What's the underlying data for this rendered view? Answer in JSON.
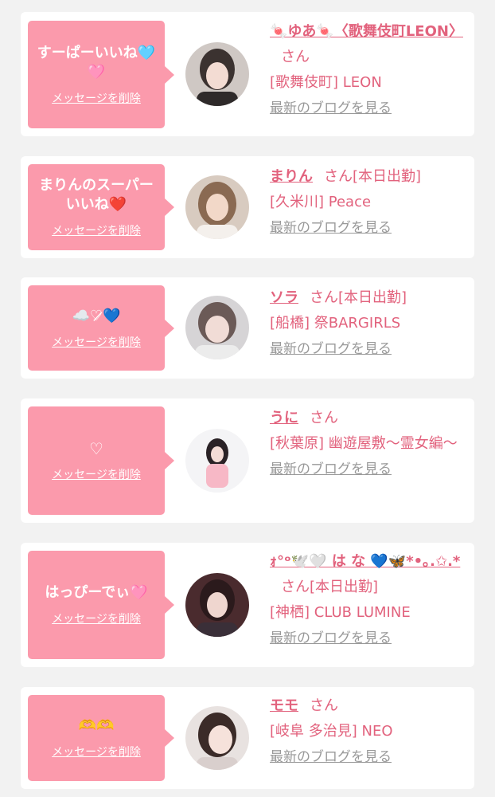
{
  "cards": [
    {
      "message": "すーぱーいいね🩵🩷",
      "delete_label": "メッセージを削除",
      "name": "🍬ゆあ🍬〈歌舞伎町LEON〉",
      "honorific": "さん",
      "status": "",
      "shop": "[歌舞伎町] LEON",
      "blog_link": "最新のブログを見る"
    },
    {
      "message": "まりんのスーパーいいね❤️",
      "delete_label": "メッセージを削除",
      "name": "まりん",
      "honorific": "さん",
      "status": "[本日出勤]",
      "shop": "[久米川] Peace",
      "blog_link": "最新のブログを見る"
    },
    {
      "message": "☁️♡̷💙",
      "delete_label": "メッセージを削除",
      "name": "ソラ",
      "honorific": "さん",
      "status": "[本日出勤]",
      "shop": "[船橋] 祭BARGIRLS",
      "blog_link": "最新のブログを見る"
    },
    {
      "message": "♡",
      "delete_label": "メッセージを削除",
      "name": "うに",
      "honorific": "さん",
      "status": "",
      "shop": "[秋葉原] 幽遊屋敷〜霊女編〜",
      "blog_link": "最新のブログを見る"
    },
    {
      "message": "はっぴーでぃ🩷",
      "delete_label": "メッセージを削除",
      "name": "ｫ°ᵒ🕊️🤍 は な 💙🦋*•｡.✩.*",
      "honorific": "さん",
      "status": "[本日出勤]",
      "shop": "[神栖] CLUB LUMINE",
      "blog_link": "最新のブログを見る"
    },
    {
      "message": "🫶🫶",
      "delete_label": "メッセージを削除",
      "name": "モモ",
      "honorific": "さん",
      "status": "",
      "shop": "[岐阜 多治見] NEO",
      "blog_link": "最新のブログを見る"
    }
  ],
  "colors": {
    "background": "#f2f2f2",
    "card": "#ffffff",
    "bubble": "#fb9aac",
    "accent_text": "#e2627d",
    "link_gray": "#999999"
  }
}
